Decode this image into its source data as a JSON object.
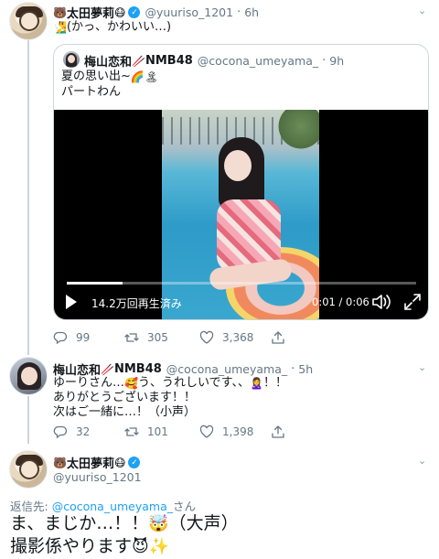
{
  "tweet1": {
    "name": "太田夢莉",
    "name_emoji_pre": "🐻",
    "name_emoji_post": "😷",
    "handle": "@yuuriso_1201",
    "dot": "·",
    "time": "6h",
    "text_emoji": "🧏‍♂️",
    "text": "(かっ、かわいい…)",
    "quote": {
      "name": "梅山恋和",
      "name_emoji": "🥢",
      "name_suffix": "NMB48",
      "handle": "@cocona_umeyama_",
      "dot": "·",
      "time": "9h",
      "line1": "夏の思い出~",
      "line1_emoji": "🌈🏝",
      "line2": "パートわん",
      "video": {
        "views": "14.2万回再生済み",
        "time": "0:01 / 0:06",
        "progress": 0.16
      }
    },
    "actions": {
      "reply": "99",
      "retweet": "305",
      "like": "3,368"
    }
  },
  "tweet2": {
    "name": "梅山恋和",
    "name_emoji": "🥢",
    "name_suffix": "NMB48",
    "handle": "@cocona_umeyama_",
    "dot": "·",
    "time": "5h",
    "line1a": "ゆーりさん…",
    "line1_emoji1": "🥰",
    "line1b": "う、うれしいです、、",
    "line1_emoji2": "🙎‍♀️",
    "line1c": "！！",
    "line2": "ありがとうございます！！",
    "line3": "次はご一緒に…！（小声）",
    "actions": {
      "reply": "32",
      "retweet": "101",
      "like": "1,398"
    }
  },
  "tweet3": {
    "name": "太田夢莉",
    "name_emoji_pre": "🐻",
    "name_emoji_post": "😷",
    "handle": "@yuuriso_1201",
    "reply_label": "返信先:",
    "reply_handle": "@cocona_umeyama_",
    "reply_suffix": "さん",
    "line1a": "ま、まじか…！！",
    "line1_emoji": "🤯",
    "line1b": "（大声）",
    "line2": "撮影係やります",
    "line2_emoji": "😈✨"
  },
  "icons": [
    "chevron-down-icon",
    "verified-icon",
    "reply-icon",
    "retweet-icon",
    "like-icon",
    "share-icon",
    "play-icon",
    "volume-icon",
    "fullscreen-icon"
  ],
  "colors": {
    "accent": "#1da1f2",
    "muted": "#657786",
    "border": "#ccd6dd"
  }
}
